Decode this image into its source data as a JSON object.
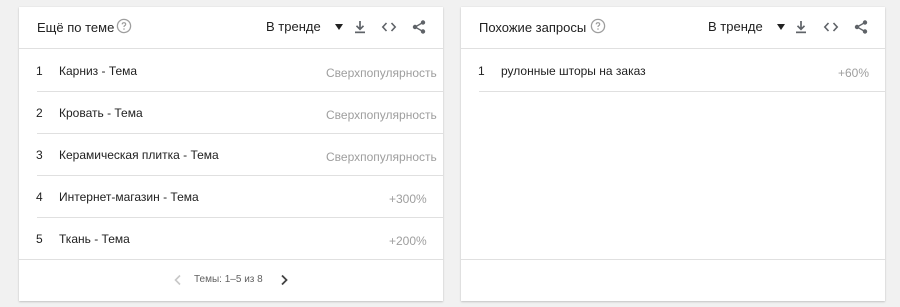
{
  "left_panel": {
    "title": "Ещё по теме",
    "filter": "В тренде",
    "rows": [
      {
        "rank": "1",
        "label": "Карниз - Тема",
        "value": "Сверхпопулярность"
      },
      {
        "rank": "2",
        "label": "Кровать - Тема",
        "value": "Сверхпопулярность"
      },
      {
        "rank": "3",
        "label": "Керамическая плитка - Тема",
        "value": "Сверхпопулярность"
      },
      {
        "rank": "4",
        "label": "Интернет-магазин - Тема",
        "value": "+300%"
      },
      {
        "rank": "5",
        "label": "Ткань - Тема",
        "value": "+200%"
      }
    ],
    "pager": "Темы: 1–5 из 8"
  },
  "right_panel": {
    "title": "Похожие запросы",
    "filter": "В тренде",
    "rows": [
      {
        "rank": "1",
        "label": "рулонные шторы на заказ",
        "value": "+60%"
      }
    ]
  },
  "colors": {
    "background": "#f1f1f1",
    "card": "#ffffff",
    "divider": "#e0e0e0",
    "muted_text": "#9e9e9e",
    "icon": "#5f6368"
  },
  "icons": [
    "help-icon",
    "download-icon",
    "embed-icon",
    "share-icon",
    "chevron-left-icon",
    "chevron-right-icon"
  ]
}
